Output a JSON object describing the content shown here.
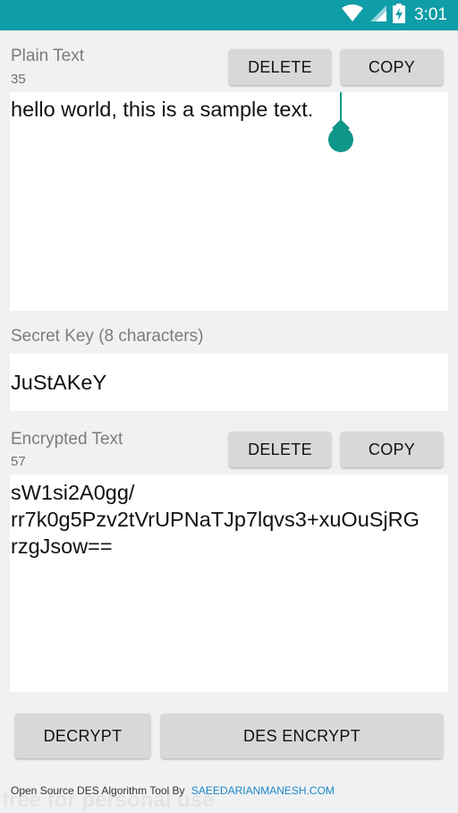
{
  "status_bar": {
    "time": "3:01",
    "icons": [
      "wifi-icon",
      "signal-icon",
      "battery-charging-icon"
    ]
  },
  "plain": {
    "label": "Plain Text",
    "count": "35",
    "delete_label": "DELETE",
    "copy_label": "COPY",
    "text": "hello world, this is a sample text."
  },
  "key": {
    "label": "Secret Key (8 characters)",
    "value": "JuStAKeY"
  },
  "encrypted": {
    "label": "Encrypted Text",
    "count": "57",
    "delete_label": "DELETE",
    "copy_label": "COPY",
    "lines": [
      "sW1si2A0gg/",
      "rr7k0g5Pzv2tVrUPNaTJp7lqvs3+xuOuSjRG",
      "rzgJsow=="
    ]
  },
  "actions": {
    "decrypt_label": "DECRYPT",
    "encrypt_label": "DES ENCRYPT"
  },
  "footer": {
    "text": "Open Source DES Algorithm Tool By",
    "link": "SAEEDARIANMANESH.COM",
    "watermark": "free for personal use"
  },
  "colors": {
    "status_bar": "#0f9da7",
    "accent": "#0f9688",
    "link": "#1e88c8"
  }
}
